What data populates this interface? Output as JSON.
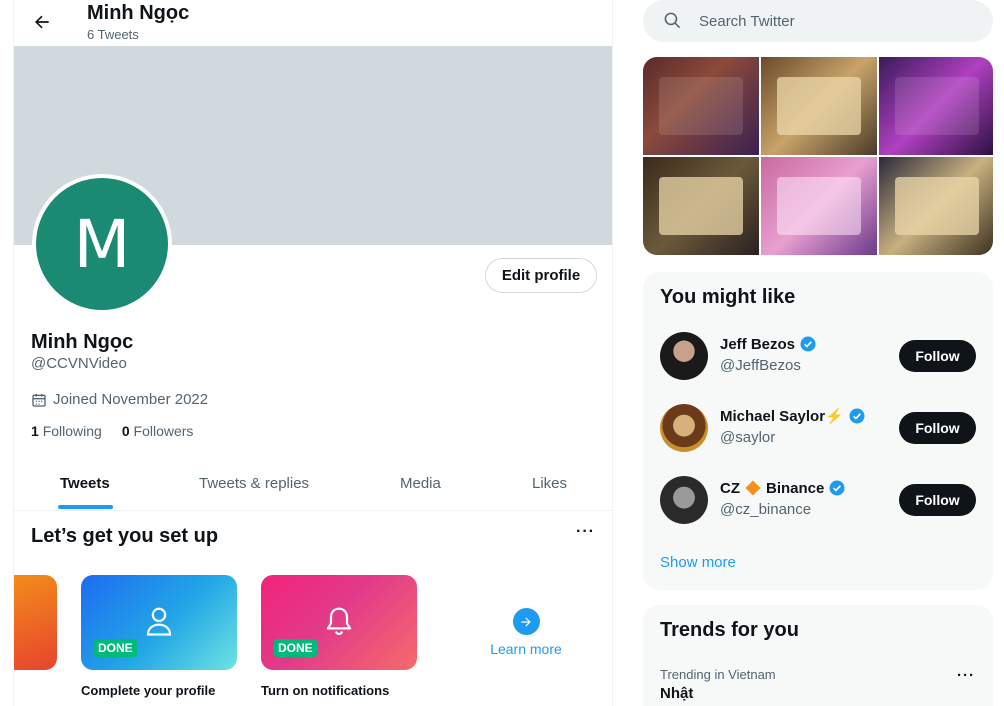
{
  "header": {
    "name": "Minh Ngọc",
    "tweet_count": "6 Tweets"
  },
  "avatar": {
    "letter": "M",
    "color": "#1a8a73"
  },
  "profile": {
    "edit_label": "Edit profile",
    "name": "Minh Ngọc",
    "handle": "@CCVNVideo",
    "joined": "Joined November 2022",
    "following_count": "1",
    "following_label": "Following",
    "followers_count": "0",
    "followers_label": "Followers"
  },
  "tabs": [
    {
      "label": "Tweets",
      "active": true
    },
    {
      "label": "Tweets & replies",
      "active": false
    },
    {
      "label": "Media",
      "active": false
    },
    {
      "label": "Likes",
      "active": false
    }
  ],
  "setup": {
    "title": "Let’s get you set up",
    "more": "···",
    "cards": [
      {
        "label": "Complete your profile",
        "badge": "DONE",
        "icon": "person-icon"
      },
      {
        "label": "Turn on notifications",
        "badge": "DONE",
        "icon": "bell-icon"
      }
    ],
    "learn_more": "Learn more"
  },
  "search": {
    "placeholder": "Search Twitter"
  },
  "who_to_follow": {
    "title": "You might like",
    "users": [
      {
        "name": "Jeff Bezos",
        "handle": "@JeffBezos",
        "follow": "Follow",
        "verified": true
      },
      {
        "name": "Michael Saylor⚡️",
        "handle": "@saylor",
        "follow": "Follow",
        "verified": true
      },
      {
        "name_prefix": "CZ",
        "name_suffix": "Binance",
        "handle": "@cz_binance",
        "follow": "Follow",
        "verified": true
      }
    ],
    "show_more": "Show more"
  },
  "trends": {
    "title": "Trends for you",
    "items": [
      {
        "context": "Trending in Vietnam",
        "name": "Nhật",
        "more": "···"
      }
    ]
  },
  "colors": {
    "accent": "#1d9bf0",
    "done_green": "#00ba7c",
    "text": "#0f1419",
    "muted": "#536471"
  }
}
